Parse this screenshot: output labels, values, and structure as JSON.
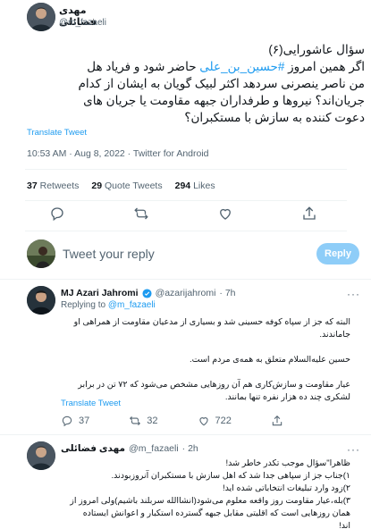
{
  "main_tweet": {
    "author_name": "مهدی فضائلی",
    "author_handle": "@m_fazaeli",
    "text_line1": "سؤال عاشورایی(۶)",
    "text_line2_a": "اگر همین امروز ",
    "text_hashtag": "#حسین_بن_علی",
    "text_line2_b": " حاضر شود و فریاد هل",
    "text_line3": "من ناصر ینصرنی سردهد اکثر لبیک گویان به ایشان از کدام",
    "text_line4": "جریان‌اند؟ نیروها و طرفداران جبهه مقاومت یا جریان های",
    "text_line5": "دعوت کننده به سازش با مستکبران؟",
    "translate": "Translate Tweet",
    "meta": "10:53 AM · Aug 8, 2022 · Twitter for Android",
    "retweets_count": "37",
    "retweets_label": "Retweets",
    "quotes_count": "29",
    "quotes_label": "Quote Tweets",
    "likes_count": "294",
    "likes_label": "Likes"
  },
  "reply_box": {
    "placeholder": "Tweet your reply",
    "button": "Reply"
  },
  "reply1": {
    "name": "MJ Azari Jahromi",
    "handle": "@azarijahromi",
    "time": "· 7h",
    "replying_prefix": "Replying to",
    "replying_handle": "@m_fazaeli",
    "p1_line1": "البته که جز از سپاه کوفه حسینی شد و بسیاری از مدعیان مقاومت از همراهی او",
    "p1_line2": "جاماندند.",
    "p2": "حسین علیه‌السلام متعلق به همه‌ی  مردم است.",
    "p3_line1": "عیار مقاومت و سازش‌کاری هم آن روزهایی مشخص می‌شود که ۷۲ تن در برابر",
    "p3_line2": "لشکری چند ده هزار نفره تنها بمانند.",
    "translate": "Translate Tweet",
    "replies": "37",
    "retweets": "32",
    "likes": "722"
  },
  "reply2": {
    "name": "مهدی فضائلی",
    "handle": "@m_fazaeli",
    "time": "· 2h",
    "line1": "ظاهرا\"سؤال موجب تکدر خاطر شد!",
    "line2": "۱)جناب جز از سپاهی جدا شد که اهل سازش با مستکبران آنروزبودند.",
    "line3": "۲)زود وارد تبلیغات انتخاباتی شده اید!",
    "line4": "۳)بله،عیار مقاومت روز واقعه معلوم می‌شود(انشاالله سربلند باشیم)ولی امروز از",
    "line5": "همان روزهایی است که اقلیتی مقابل جبهه گسترده استکبار و اعوانش ایستاده",
    "line6": "اند!"
  },
  "colors": {
    "accent": "#1d9bf0",
    "reply_button_bg": "#8ecdf8",
    "verified": "#1d9bf0",
    "text_muted": "#536471"
  }
}
